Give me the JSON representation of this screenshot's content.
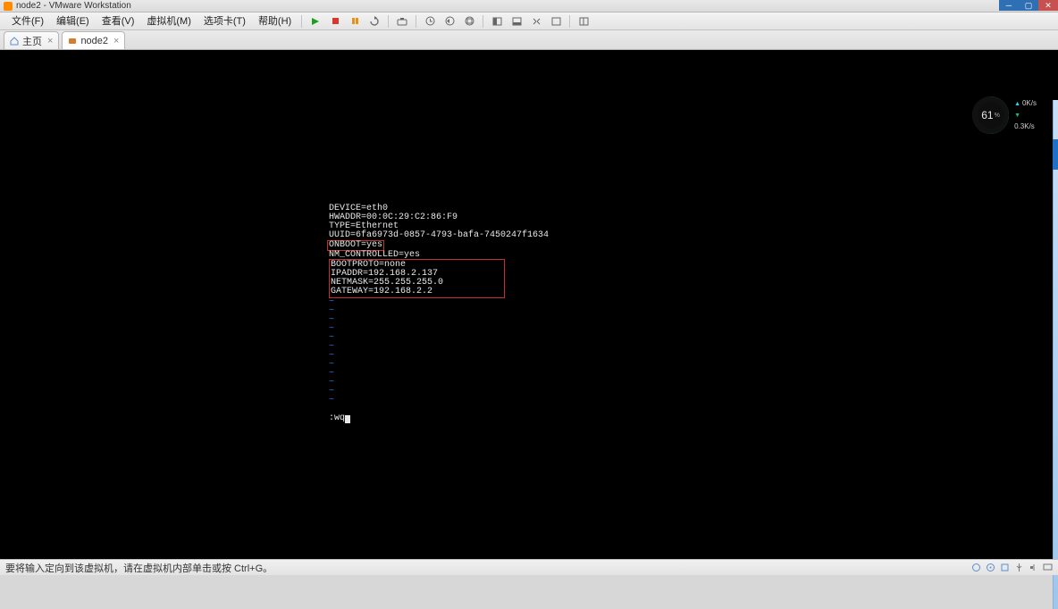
{
  "window": {
    "title": "node2 - VMware Workstation"
  },
  "menu": {
    "file": "文件(F)",
    "edit": "编辑(E)",
    "view": "查看(V)",
    "vm": "虚拟机(M)",
    "tabs": "选项卡(T)",
    "help": "帮助(H)"
  },
  "tabs": {
    "home": "主页",
    "node2": "node2"
  },
  "terminal": {
    "lines_before": [
      "DEVICE=eth0",
      "HWADDR=00:0C:29:C2:86:F9",
      "TYPE=Ethernet",
      "UUID=6fa6973d-0857-4793-bafa-7450247f1634"
    ],
    "boxed_line_1": "ONBOOT=yes",
    "line_between": "NM_CONTROLLED=yes",
    "boxed_lines_2": [
      "BOOTPROTO=none",
      "IPADDR=192.168.2.137",
      "NETMASK=255.255.255.0",
      "GATEWAY=192.168.2.2"
    ],
    "tilde_count": 12,
    "command": ":wq"
  },
  "perf": {
    "percent": "61",
    "unit": "%",
    "up": "0K/s",
    "down": "0.3K/s"
  },
  "status": {
    "hint": "要将输入定向到该虚拟机，请在虚拟机内部单击或按 Ctrl+G。"
  }
}
